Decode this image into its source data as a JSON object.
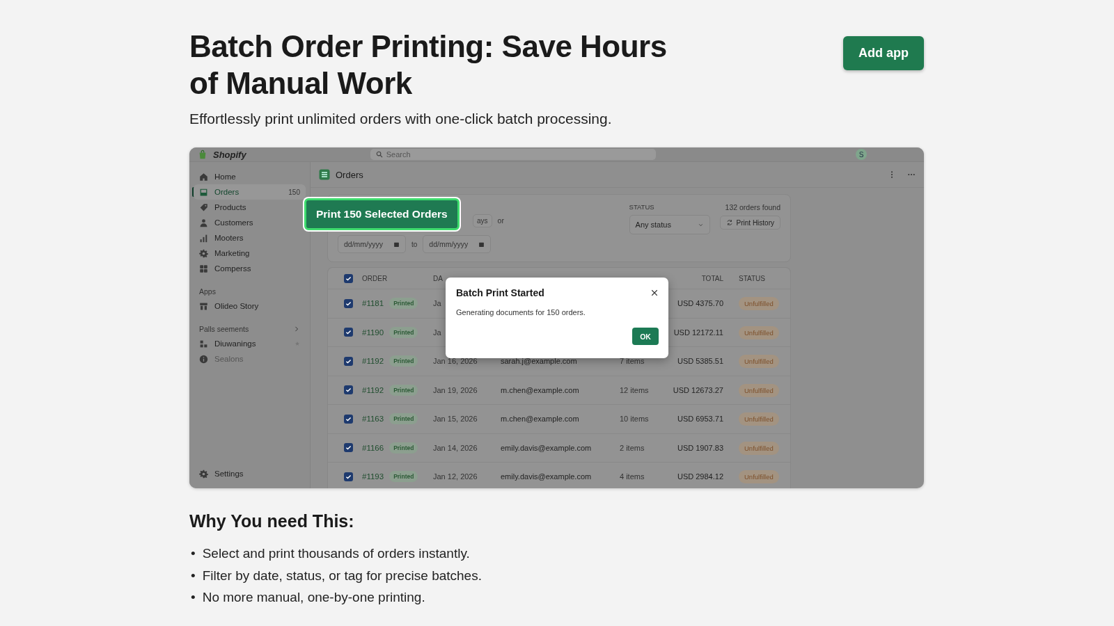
{
  "heading": "Batch Order Printing: Save Hours of Manual Work",
  "add_button": "Add app",
  "subtitle": "Effortlessly print unlimited orders with one-click batch processing.",
  "screenshot": {
    "topbar": {
      "logo": "Shopify",
      "search_placeholder": "Search",
      "avatar": "S"
    },
    "sidebar": {
      "items": [
        {
          "label": "Home",
          "selected": false
        },
        {
          "label": "Orders",
          "selected": true,
          "badge": "150"
        },
        {
          "label": "Products",
          "selected": false
        },
        {
          "label": "Customers",
          "selected": false
        },
        {
          "label": "Mooters",
          "selected": false
        },
        {
          "label": "Marketing",
          "selected": false
        },
        {
          "label": "Comperss",
          "selected": false
        }
      ],
      "apps_label": "Apps",
      "apps": [
        {
          "label": "Olideo Story"
        }
      ],
      "section": {
        "label": "Palls seements",
        "items": [
          {
            "label": "Diuwanings",
            "disabled": false
          },
          {
            "label": "Sealons",
            "disabled": true
          }
        ]
      },
      "settings": "Settings"
    },
    "page_title": "Orders",
    "filters": {
      "chip": "ays",
      "or": "or",
      "date_from": "dd/mm/yyyy",
      "to": "to",
      "date_to": "dd/mm/yyyy",
      "status_label": "STATUS",
      "status_value": "Any status",
      "count": "132 orders found",
      "history_button": "Print History"
    },
    "table": {
      "header_checked": true,
      "columns": {
        "order": "ORDER",
        "date": "DA",
        "total": "TOTAL",
        "status": "STATUS"
      },
      "rows": [
        {
          "checked": true,
          "order": "#1181",
          "tag": "Printed",
          "date": "Ja",
          "total": "USD 4375.70",
          "status": "Unfulfilled"
        },
        {
          "checked": true,
          "order": "#1190",
          "tag": "Printed",
          "date": "Ja",
          "total": "USD 12172.11",
          "status": "Unfulfilled"
        },
        {
          "checked": true,
          "order": "#1192",
          "tag": "Printed",
          "date": "Jan 16, 2026",
          "customer": "sarah.j@example.com",
          "items": "7 items",
          "total": "USD 5385.51",
          "status": "Unfulfilled"
        },
        {
          "checked": true,
          "order": "#1192",
          "tag": "Printed",
          "date": "Jan 19, 2026",
          "customer": "m.chen@example.com",
          "items": "12 items",
          "total": "USD 12673.27",
          "status": "Unfulfilled"
        },
        {
          "checked": true,
          "order": "#1163",
          "tag": "Printed",
          "date": "Jan 15, 2026",
          "customer": "m.chen@example.com",
          "items": "10 items",
          "total": "USD 6953.71",
          "status": "Unfulfilled"
        },
        {
          "checked": true,
          "order": "#1166",
          "tag": "Printed",
          "date": "Jan 14, 2026",
          "customer": "emily.davis@example.com",
          "items": "2 items",
          "total": "USD 1907.83",
          "status": "Unfulfilled"
        },
        {
          "checked": true,
          "order": "#1193",
          "tag": "Printed",
          "date": "Jan 12, 2026",
          "customer": "emily.davis@example.com",
          "items": "4 items",
          "total": "USD 2984.12",
          "status": "Unfulfilled"
        }
      ]
    },
    "print_button": "Print 150 Selected Orders",
    "dialog": {
      "title": "Batch Print Started",
      "message": "Generating documents for 150 orders.",
      "ok": "OK"
    }
  },
  "why_heading": "Why You need This:",
  "bullets": [
    {
      "marker": "•",
      "text": "Select and print thousands of orders instantly."
    },
    {
      "marker": "•",
      "text": "Filter by date, status, or tag for precise batches."
    },
    {
      "marker": "•",
      "text": "No more manual, one-by-one printing."
    }
  ]
}
